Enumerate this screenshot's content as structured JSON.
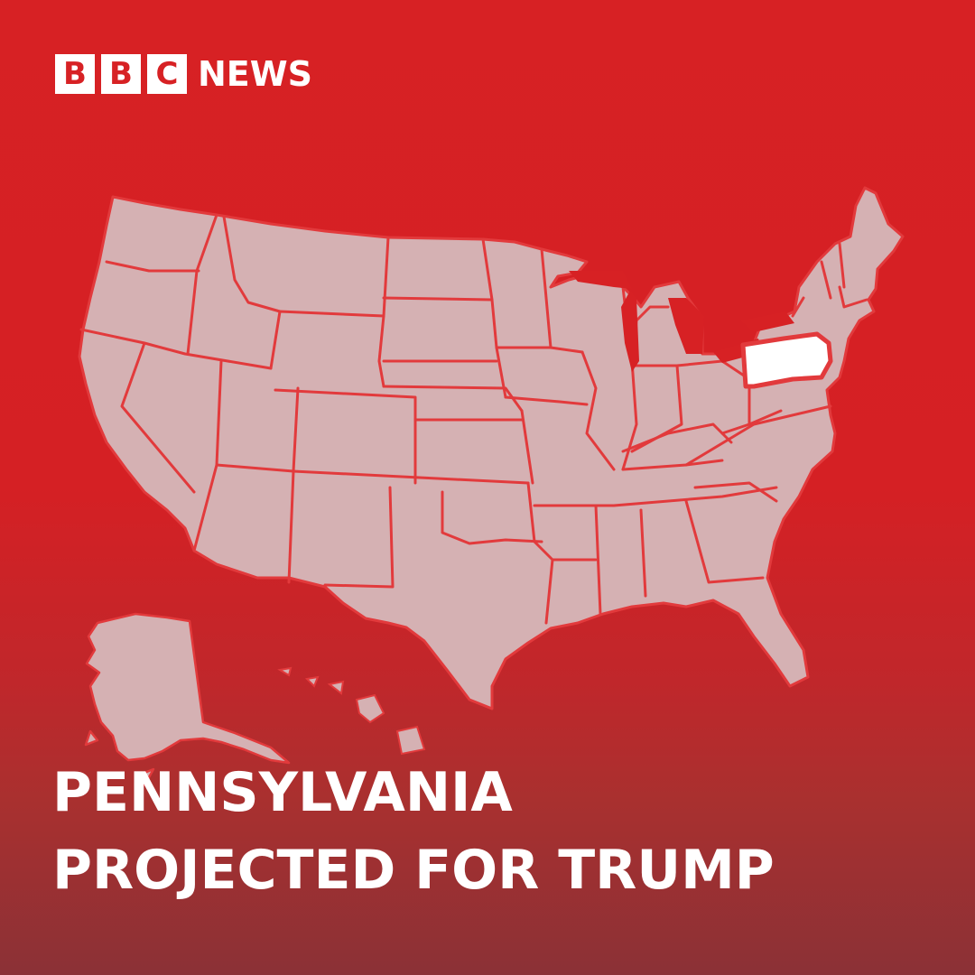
{
  "logo": {
    "letters": [
      "B",
      "B",
      "C"
    ],
    "word": "NEWS"
  },
  "map": {
    "highlighted_state": "Pennsylvania",
    "colors": {
      "background": "#d72124",
      "states_fill": "#d5b1b3",
      "borders": "#e23a3c",
      "highlight_fill": "#ffffff"
    }
  },
  "headline": {
    "line1": "PENNSYLVANIA",
    "line2": "PROJECTED FOR TRUMP"
  }
}
